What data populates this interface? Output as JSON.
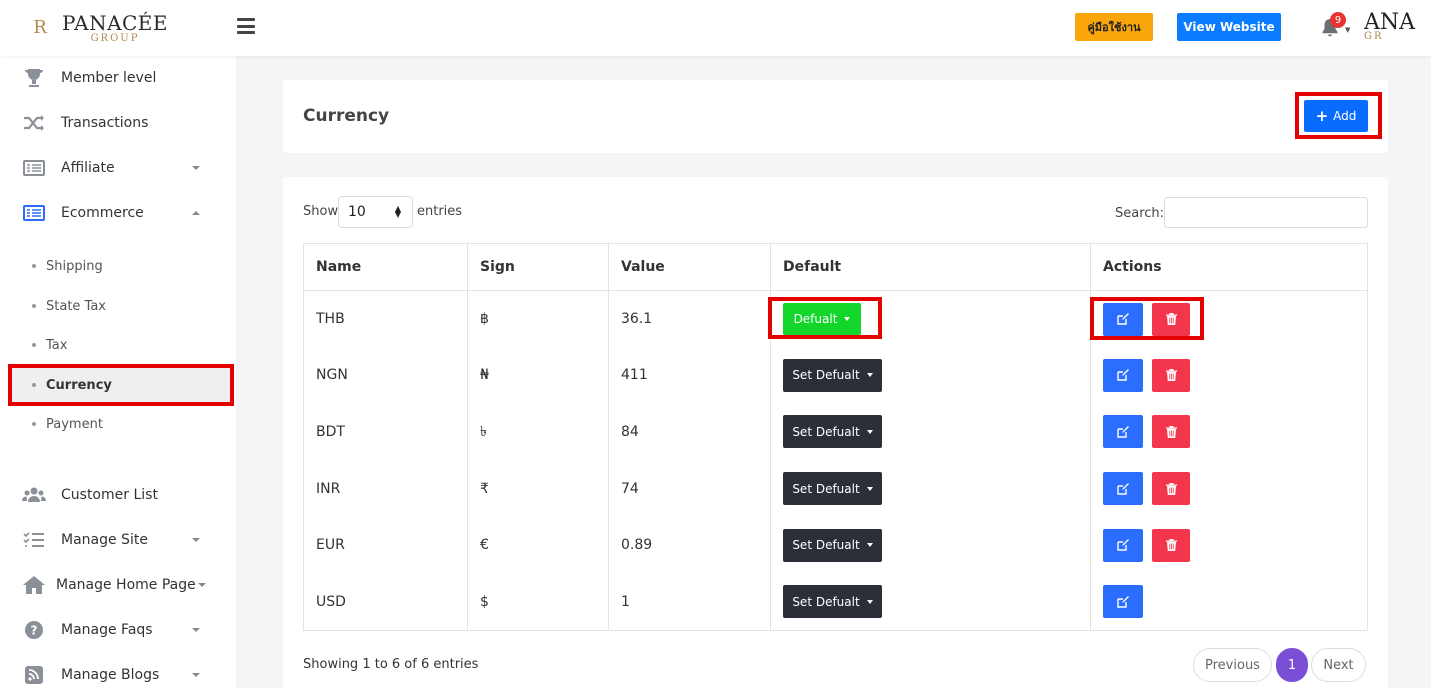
{
  "header": {
    "logo_emblem": "R",
    "logo_name": "PANACÉE",
    "logo_sub": "GROUP",
    "manual_label": "คู่มือใช้งาน",
    "view_website_label": "View Website",
    "notification_count": "9",
    "brand_partial": "ANA",
    "brand_partial_sub": "GR"
  },
  "sidebar": {
    "items": [
      {
        "label": "Member level",
        "icon": "trophy-icon"
      },
      {
        "label": "Transactions",
        "icon": "shuffle-icon"
      },
      {
        "label": "Affiliate",
        "icon": "list-icon"
      },
      {
        "label": "Ecommerce",
        "icon": "table-icon"
      }
    ],
    "subitems": [
      "Shipping",
      "State Tax",
      "Tax",
      "Currency",
      "Payment"
    ],
    "items2": [
      {
        "label": "Customer List",
        "icon": "users-icon"
      },
      {
        "label": "Manage Site",
        "icon": "tasks-icon"
      },
      {
        "label": "Manage Home Page",
        "icon": "home-icon"
      },
      {
        "label": "Manage Faqs",
        "icon": "question-icon"
      },
      {
        "label": "Manage Blogs",
        "icon": "rss-icon"
      }
    ]
  },
  "page": {
    "title": "Currency",
    "add_label": "Add"
  },
  "table_controls": {
    "show_label": "Show",
    "entries_value": "10",
    "entries_label": "entries",
    "search_label": "Search:"
  },
  "table": {
    "columns": [
      "Name",
      "Sign",
      "Value",
      "Default",
      "Actions"
    ],
    "rows": [
      {
        "name": "THB",
        "sign": "฿",
        "value": "36.1",
        "default_label": "Defualt"
      },
      {
        "name": "NGN",
        "sign": "₦",
        "value": "411",
        "default_label": "Set Defualt"
      },
      {
        "name": "BDT",
        "sign": "৳",
        "value": "84",
        "default_label": "Set Defualt"
      },
      {
        "name": "INR",
        "sign": "₹",
        "value": "74",
        "default_label": "Set Defualt"
      },
      {
        "name": "EUR",
        "sign": "€",
        "value": "0.89",
        "default_label": "Set Defualt"
      },
      {
        "name": "USD",
        "sign": "$",
        "value": "1",
        "default_label": "Set Defualt"
      }
    ]
  },
  "pagination": {
    "info": "Showing 1 to 6 of 6 entries",
    "previous": "Previous",
    "current": "1",
    "next": "Next"
  },
  "colors": {
    "accent_blue": "#0a7cff",
    "manual_orange": "#f9a60a",
    "default_green": "#12d62a",
    "delete_red": "#f4364c",
    "highlight_red": "#e50000",
    "page_active": "#7a4fd6"
  }
}
